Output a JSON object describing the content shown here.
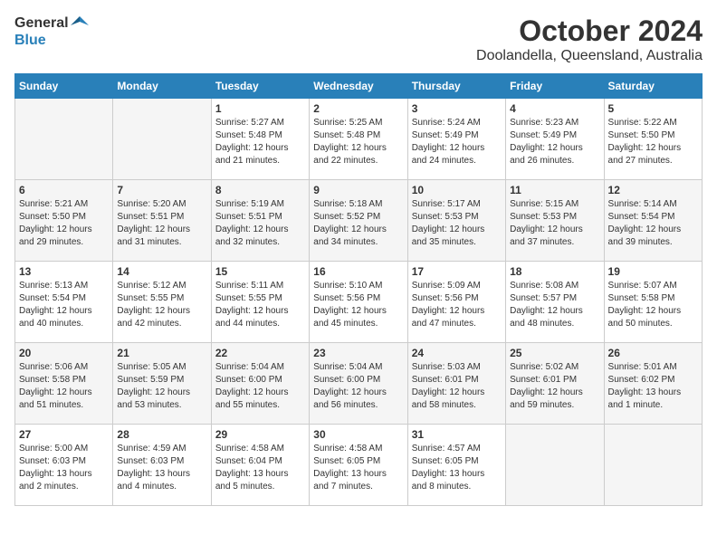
{
  "header": {
    "logo_general": "General",
    "logo_blue": "Blue",
    "month": "October 2024",
    "location": "Doolandella, Queensland, Australia"
  },
  "days_of_week": [
    "Sunday",
    "Monday",
    "Tuesday",
    "Wednesday",
    "Thursday",
    "Friday",
    "Saturday"
  ],
  "weeks": [
    [
      {
        "num": "",
        "info": "",
        "empty": true
      },
      {
        "num": "",
        "info": "",
        "empty": true
      },
      {
        "num": "1",
        "info": "Sunrise: 5:27 AM\nSunset: 5:48 PM\nDaylight: 12 hours\nand 21 minutes."
      },
      {
        "num": "2",
        "info": "Sunrise: 5:25 AM\nSunset: 5:48 PM\nDaylight: 12 hours\nand 22 minutes."
      },
      {
        "num": "3",
        "info": "Sunrise: 5:24 AM\nSunset: 5:49 PM\nDaylight: 12 hours\nand 24 minutes."
      },
      {
        "num": "4",
        "info": "Sunrise: 5:23 AM\nSunset: 5:49 PM\nDaylight: 12 hours\nand 26 minutes."
      },
      {
        "num": "5",
        "info": "Sunrise: 5:22 AM\nSunset: 5:50 PM\nDaylight: 12 hours\nand 27 minutes."
      }
    ],
    [
      {
        "num": "6",
        "info": "Sunrise: 5:21 AM\nSunset: 5:50 PM\nDaylight: 12 hours\nand 29 minutes."
      },
      {
        "num": "7",
        "info": "Sunrise: 5:20 AM\nSunset: 5:51 PM\nDaylight: 12 hours\nand 31 minutes."
      },
      {
        "num": "8",
        "info": "Sunrise: 5:19 AM\nSunset: 5:51 PM\nDaylight: 12 hours\nand 32 minutes."
      },
      {
        "num": "9",
        "info": "Sunrise: 5:18 AM\nSunset: 5:52 PM\nDaylight: 12 hours\nand 34 minutes."
      },
      {
        "num": "10",
        "info": "Sunrise: 5:17 AM\nSunset: 5:53 PM\nDaylight: 12 hours\nand 35 minutes."
      },
      {
        "num": "11",
        "info": "Sunrise: 5:15 AM\nSunset: 5:53 PM\nDaylight: 12 hours\nand 37 minutes."
      },
      {
        "num": "12",
        "info": "Sunrise: 5:14 AM\nSunset: 5:54 PM\nDaylight: 12 hours\nand 39 minutes."
      }
    ],
    [
      {
        "num": "13",
        "info": "Sunrise: 5:13 AM\nSunset: 5:54 PM\nDaylight: 12 hours\nand 40 minutes."
      },
      {
        "num": "14",
        "info": "Sunrise: 5:12 AM\nSunset: 5:55 PM\nDaylight: 12 hours\nand 42 minutes."
      },
      {
        "num": "15",
        "info": "Sunrise: 5:11 AM\nSunset: 5:55 PM\nDaylight: 12 hours\nand 44 minutes."
      },
      {
        "num": "16",
        "info": "Sunrise: 5:10 AM\nSunset: 5:56 PM\nDaylight: 12 hours\nand 45 minutes."
      },
      {
        "num": "17",
        "info": "Sunrise: 5:09 AM\nSunset: 5:56 PM\nDaylight: 12 hours\nand 47 minutes."
      },
      {
        "num": "18",
        "info": "Sunrise: 5:08 AM\nSunset: 5:57 PM\nDaylight: 12 hours\nand 48 minutes."
      },
      {
        "num": "19",
        "info": "Sunrise: 5:07 AM\nSunset: 5:58 PM\nDaylight: 12 hours\nand 50 minutes."
      }
    ],
    [
      {
        "num": "20",
        "info": "Sunrise: 5:06 AM\nSunset: 5:58 PM\nDaylight: 12 hours\nand 51 minutes."
      },
      {
        "num": "21",
        "info": "Sunrise: 5:05 AM\nSunset: 5:59 PM\nDaylight: 12 hours\nand 53 minutes."
      },
      {
        "num": "22",
        "info": "Sunrise: 5:04 AM\nSunset: 6:00 PM\nDaylight: 12 hours\nand 55 minutes."
      },
      {
        "num": "23",
        "info": "Sunrise: 5:04 AM\nSunset: 6:00 PM\nDaylight: 12 hours\nand 56 minutes."
      },
      {
        "num": "24",
        "info": "Sunrise: 5:03 AM\nSunset: 6:01 PM\nDaylight: 12 hours\nand 58 minutes."
      },
      {
        "num": "25",
        "info": "Sunrise: 5:02 AM\nSunset: 6:01 PM\nDaylight: 12 hours\nand 59 minutes."
      },
      {
        "num": "26",
        "info": "Sunrise: 5:01 AM\nSunset: 6:02 PM\nDaylight: 13 hours\nand 1 minute."
      }
    ],
    [
      {
        "num": "27",
        "info": "Sunrise: 5:00 AM\nSunset: 6:03 PM\nDaylight: 13 hours\nand 2 minutes."
      },
      {
        "num": "28",
        "info": "Sunrise: 4:59 AM\nSunset: 6:03 PM\nDaylight: 13 hours\nand 4 minutes."
      },
      {
        "num": "29",
        "info": "Sunrise: 4:58 AM\nSunset: 6:04 PM\nDaylight: 13 hours\nand 5 minutes."
      },
      {
        "num": "30",
        "info": "Sunrise: 4:58 AM\nSunset: 6:05 PM\nDaylight: 13 hours\nand 7 minutes."
      },
      {
        "num": "31",
        "info": "Sunrise: 4:57 AM\nSunset: 6:05 PM\nDaylight: 13 hours\nand 8 minutes."
      },
      {
        "num": "",
        "info": "",
        "empty": true
      },
      {
        "num": "",
        "info": "",
        "empty": true
      }
    ]
  ]
}
